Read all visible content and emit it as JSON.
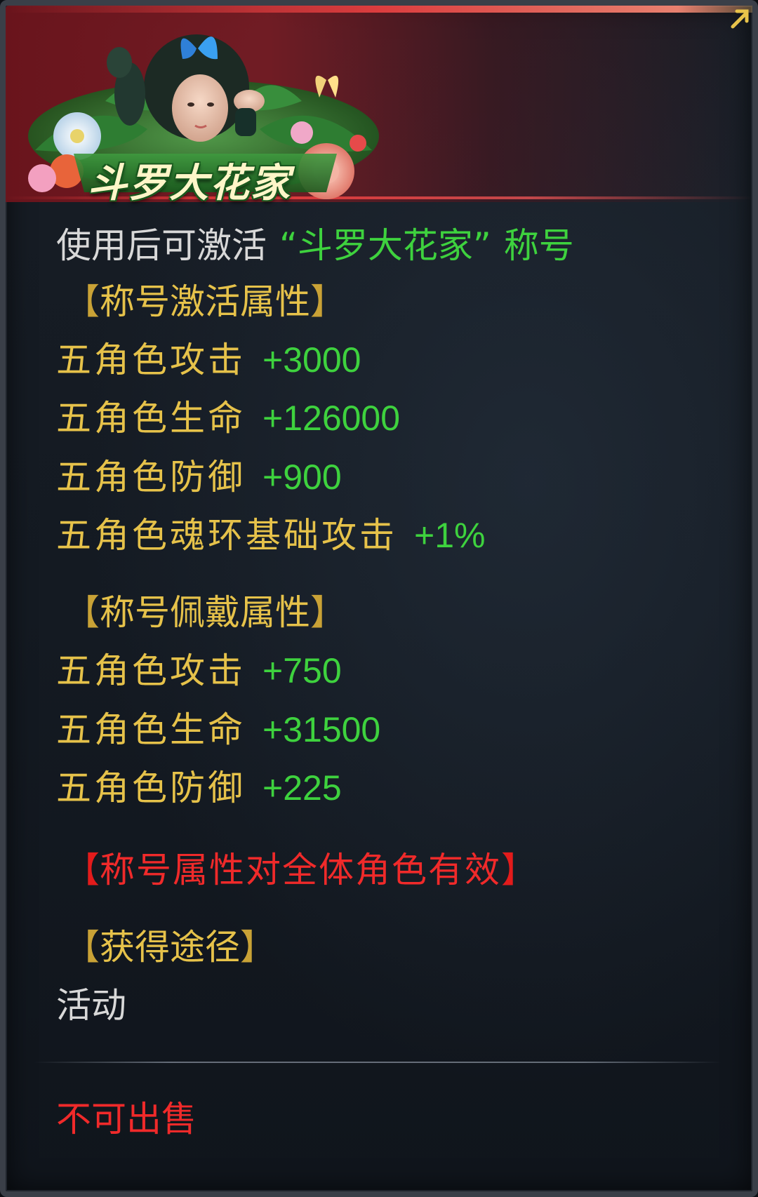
{
  "title_badge": {
    "name": "斗罗大花家"
  },
  "description": {
    "prefix": "使用后可激活",
    "title_quoted": "“斗罗大花家”",
    "suffix": "称号"
  },
  "activate_section": {
    "header": "称号激活属性",
    "stats": [
      {
        "name": "五角色攻击",
        "value": "+3000"
      },
      {
        "name": "五角色生命",
        "value": "+126000"
      },
      {
        "name": "五角色防御",
        "value": "+900"
      },
      {
        "name": "五角色魂环基础攻击",
        "value": "+1%"
      }
    ]
  },
  "wear_section": {
    "header": "称号佩戴属性",
    "stats": [
      {
        "name": "五角色攻击",
        "value": "+750"
      },
      {
        "name": "五角色生命",
        "value": "+31500"
      },
      {
        "name": "五角色防御",
        "value": "+225"
      }
    ]
  },
  "notice": "称号属性对全体角色有效",
  "obtain_section": {
    "header": "获得途径",
    "value": "活动"
  },
  "sell_status": "不可出售",
  "brackets": {
    "open": "【",
    "close": "】"
  },
  "colors": {
    "gold_text": "#e6c24a",
    "green_value": "#3ed23e",
    "red_notice": "#f02a2a",
    "white_text": "#d8d8d8",
    "banner_red": "#80141c"
  }
}
